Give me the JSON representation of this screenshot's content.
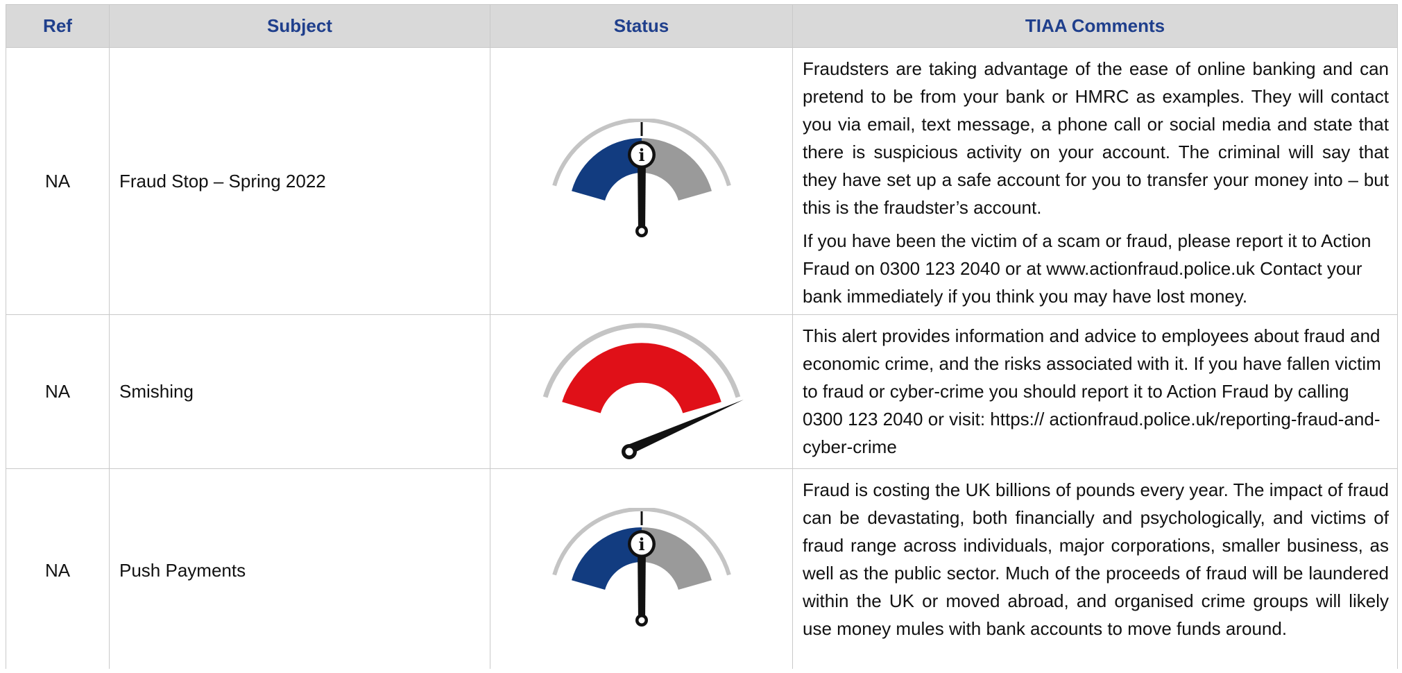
{
  "table": {
    "headers": {
      "ref": "Ref",
      "subject": "Subject",
      "status": "Status",
      "comments": "TIAA Comments"
    },
    "rows": [
      {
        "ref": "NA",
        "subject": "Fraud Stop – Spring 2022",
        "status_icon": "info-gauge-icon",
        "comments": [
          "Fraudsters are taking advantage of the ease of online banking and can pretend to be from your bank or HMRC as examples. They will contact you via email, text message, a phone call or social media and state that there is suspicious activity on your account. The criminal will say that they have set up a safe account for you to transfer your money into – but this is the fraudster’s account.",
          "If you have been the victim of a scam or fraud, please report it to Action Fraud on 0300 123 2040 or at www.actionfraud.police.uk Contact your bank immediately if you think you may have lost money."
        ]
      },
      {
        "ref": "NA",
        "subject": "Smishing",
        "status_icon": "high-risk-gauge-icon",
        "comments": [
          "This alert provides information and advice to employees about fraud and economic crime, and the risks associated with it. If you have fallen victim to fraud or cyber-crime you should report it to Action Fraud by calling 0300 123 2040 or visit: https:// actionfraud.police.uk/reporting-fraud-and-cyber-crime"
        ]
      },
      {
        "ref": "NA",
        "subject": "Push Payments",
        "status_icon": "info-gauge-icon",
        "comments": [
          "Fraud is costing the UK billions of pounds every year. The impact of fraud can be devastating, both financially and psychologically, and victims of fraud range across individuals, major corporations, smaller business, as well as the public sector. Much of the proceeds of fraud will be laundered within the UK or moved abroad, and organised crime groups will likely use money mules with bank accounts to move funds around."
        ]
      }
    ]
  },
  "colors": {
    "header_text": "#1f3f8c",
    "header_bg": "#d9d9d9",
    "gauge_blue": "#123c80",
    "gauge_grey": "#9a9a9a",
    "gauge_red": "#e01018"
  }
}
